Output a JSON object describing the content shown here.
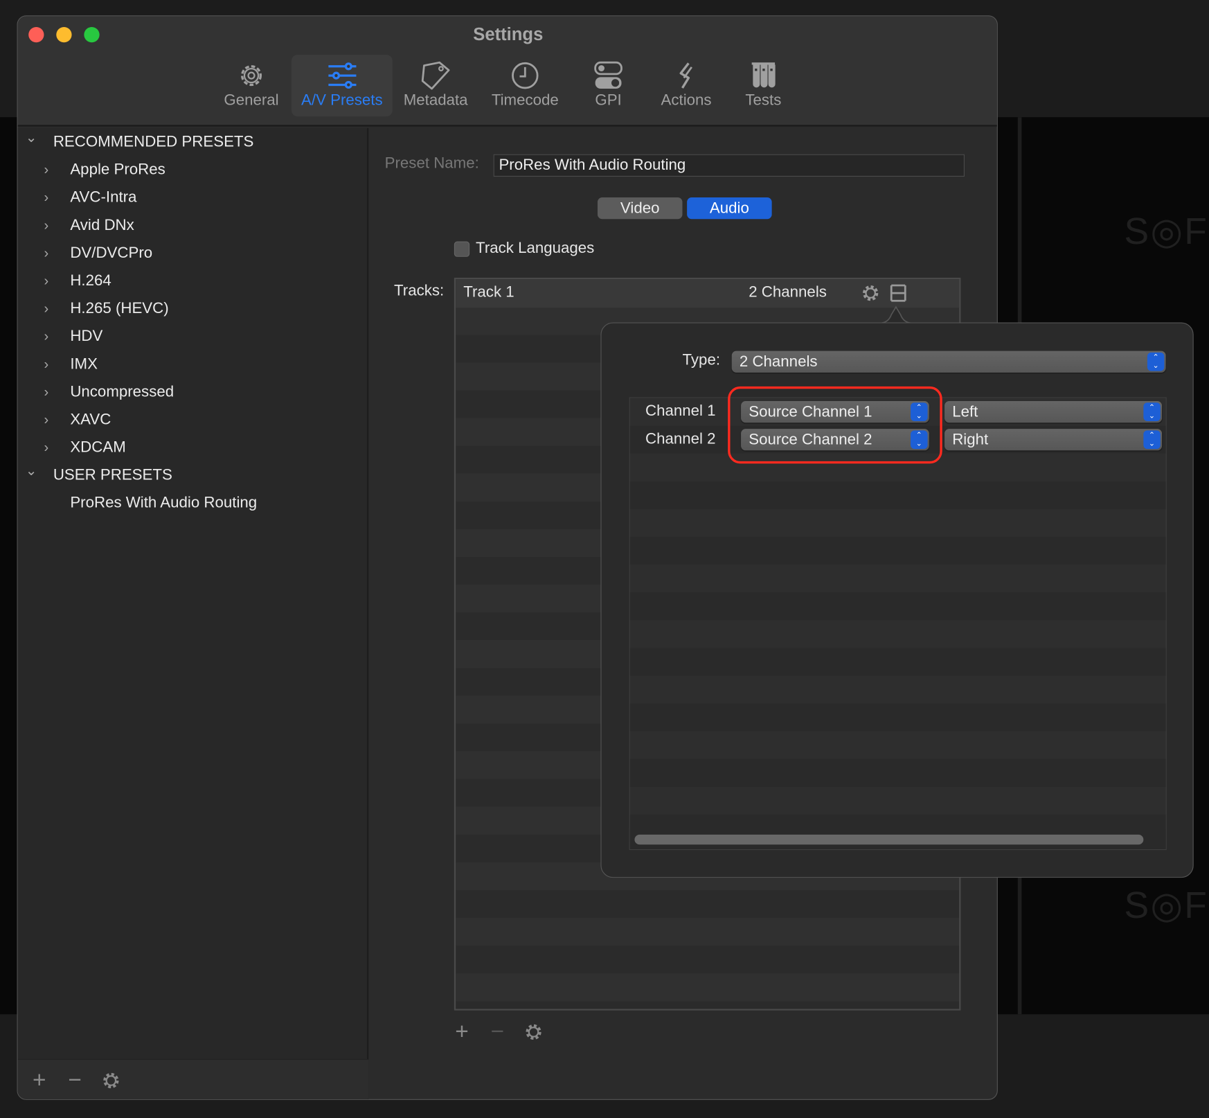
{
  "window": {
    "title": "Settings"
  },
  "watermark": "S◎FT",
  "toolbar": {
    "tabs": [
      {
        "label": "General",
        "icon": "gear-icon"
      },
      {
        "label": "A/V Presets",
        "icon": "sliders-icon",
        "selected": true
      },
      {
        "label": "Metadata",
        "icon": "tag-icon"
      },
      {
        "label": "Timecode",
        "icon": "clock-icon"
      },
      {
        "label": "GPI",
        "icon": "toggle-switch-icon"
      },
      {
        "label": "Actions",
        "icon": "link-icon"
      },
      {
        "label": "Tests",
        "icon": "test-tubes-icon"
      }
    ]
  },
  "sidebar": {
    "recommended_header": "RECOMMENDED PRESETS",
    "recommended": [
      "Apple ProRes",
      "AVC-Intra",
      "Avid DNx",
      "DV/DVCPro",
      "H.264",
      "H.265 (HEVC)",
      "HDV",
      "IMX",
      "Uncompressed",
      "XAVC",
      "XDCAM"
    ],
    "user_header": "USER PRESETS",
    "user": [
      "ProRes With Audio Routing"
    ],
    "add": "+",
    "remove": "−"
  },
  "main": {
    "preset_name_label": "Preset Name:",
    "preset_name_value": "ProRes With Audio Routing",
    "segments": [
      "Video",
      "Audio"
    ],
    "selected_segment": "Audio",
    "track_languages_label": "Track Languages",
    "track_languages_checked": false,
    "tracks_label": "Tracks:",
    "tracks": [
      {
        "name": "Track 1",
        "channels": "2 Channels"
      }
    ],
    "add": "+",
    "remove": "−"
  },
  "popover": {
    "type_label": "Type:",
    "type_value": "2 Channels",
    "channels": [
      {
        "label": "Channel 1",
        "source": "Source Channel 1",
        "position": "Left"
      },
      {
        "label": "Channel 2",
        "source": "Source Channel 2",
        "position": "Right"
      }
    ],
    "highlight_color": "#ff2a1f"
  },
  "colors": {
    "accent": "#2a7df5",
    "segment_selected": "#1d62d9"
  }
}
